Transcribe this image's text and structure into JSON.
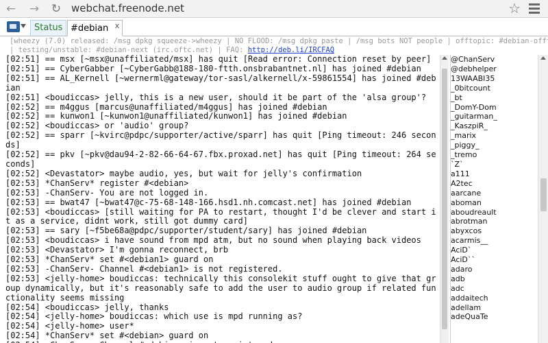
{
  "browser": {
    "url": "webchat.freenode.net"
  },
  "tabs": {
    "status": "Status",
    "channel": "#debian",
    "close_glyph": "x"
  },
  "topic": {
    "line1": "[wheezy (7.0) released: /msg dpkg squeeze->wheezy | NO FLOOD: /msg dpkg paste | /msg bots NOT people | offtopic: #debian-offtopic",
    "line2_prefix": "| testing/unstable: #debian-next (irc.oftc.net) | FAQ: ",
    "line2_link": "http://deb.li/IRCFAQ",
    "line2_suffix": ""
  },
  "chat": {
    "lines": [
      "[02:51] == msx [~msx@unaffiliated/msx] has quit [Read error: Connection reset by peer]",
      "[02:51] == CyberGabber [~CyberGabb@188-180-ftth.onsbrabantnet.nl] has joined #debian",
      "[02:51] == AL_Kernell [~wernerml@gateway/tor-sasl/alkernell/x-59861554] has joined #debian",
      "[02:51] <boudiccas> jelly, this is a new user, should it be part of the 'alsa group'?",
      "[02:52] == m4ggus [marcus@unaffiliated/m4ggus] has joined #debian",
      "[02:52] == kunwon1 [~kunwon1@unaffiliated/kunwon1] has joined #debian",
      "[02:52] <boudiccas> or 'audio' group?",
      "[02:52] == sparr [~kvirc@pdpc/supporter/active/sparr] has quit [Ping timeout: 246 seconds]",
      "[02:52] == pkv [~pkv@dau94-2-82-66-64-67.fbx.proxad.net] has quit [Ping timeout: 264 seconds]",
      "[02:52] <Devastator> maybe audio, yes, but wait for jelly's confirmation",
      "[02:53] *ChanServ* register #<debian>",
      "[02:53] -ChanServ- You are not logged in.",
      "[02:53] == bwat47 [~bwat47@c-75-68-148-166.hsd1.nh.comcast.net] has joined #debian",
      "[02:53] <boudiccas> [still waiting for PA to restart, thought I'd be clever and start it as a service, didnt work, still got dummy card]",
      "[02:53] == sary [~f5be68a@pdpc/supporter/student/sary] has joined #debian",
      "[02:53] <boudiccas> i have sound from mpd atm, but no sound when playing back videos",
      "[02:53] <Devastator> I'm gonna reconnect, brb",
      "[02:53] *ChanServ* set #<debian1> guard on",
      "[02:53] -ChanServ- Channel #<debian1> is not registered.",
      "[02:53] <jelly-home> boudiccas: technically this consolekit stuff ought to give that group dynamically, but it's reasonably safe to add the user to audio group if related functionality seems missing",
      "[02:54] <boudiccas> jelly, thanks",
      "[02:54] <jelly-home> boudiccas: which use is mpd running as?",
      "[02:54] <jelly-home> user*",
      "[02:54] *ChanServ* set #<debian> guard on",
      "[02:54] -ChanServ- Channel #<debian> is not registered."
    ]
  },
  "nicklist": {
    "nicks": [
      "@ChanServ",
      "@debhelper",
      "13WAABI35",
      "_0bitcount",
      "_bt",
      "_DomY-Dom",
      "_guitarman_",
      "_KaszpiR_",
      "_marix",
      "_piggy_",
      "_tremo",
      "`Z`",
      "a111",
      "A2tec",
      "aarcane",
      "aboman",
      "aboudreault",
      "abrotman",
      "abyxcos",
      "acarmis__",
      "AciD`",
      "AciD``",
      "adaro",
      "adb",
      "adc",
      "addaitech",
      "adellam",
      "adeQuaTe"
    ]
  },
  "icons": {
    "back": "back-arrow-icon",
    "forward": "forward-arrow-icon",
    "reload": "reload-icon",
    "star": "star-icon",
    "menu": "menu-icon",
    "app": "chat-app-icon"
  },
  "colors": {
    "status_tab_text": "#2d7a2d",
    "topic_text": "#9a9a9a",
    "link": "#1a3fcf"
  }
}
